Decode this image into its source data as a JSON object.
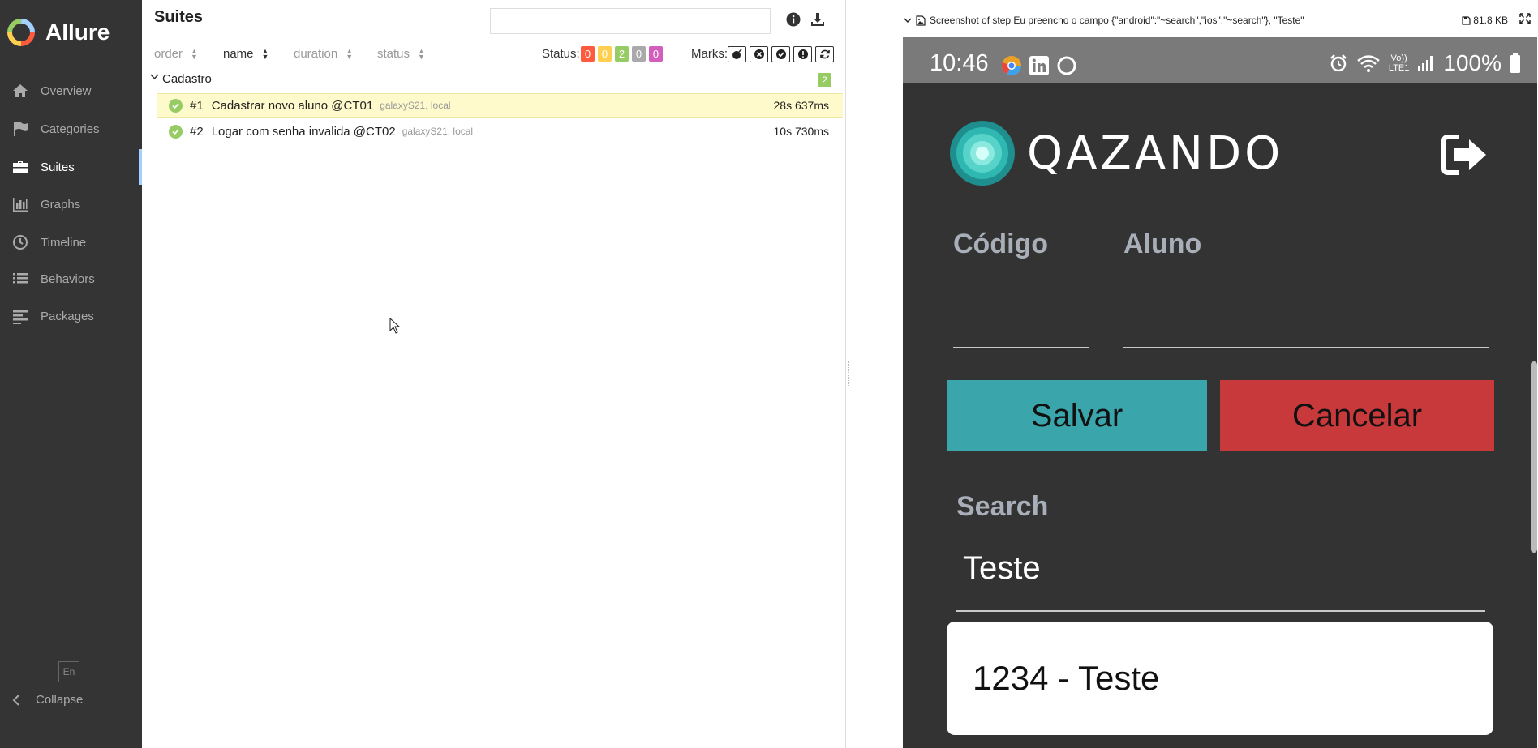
{
  "app": {
    "name": "Allure"
  },
  "sidebar": {
    "items": [
      {
        "label": "Overview"
      },
      {
        "label": "Categories"
      },
      {
        "label": "Suites"
      },
      {
        "label": "Graphs"
      },
      {
        "label": "Timeline"
      },
      {
        "label": "Behaviors"
      },
      {
        "label": "Packages"
      }
    ],
    "active": "Suites",
    "language": "En",
    "collapse_label": "Collapse"
  },
  "suites": {
    "title": "Suites",
    "search_value": "",
    "columns": [
      {
        "label": "order"
      },
      {
        "label": "name"
      },
      {
        "label": "duration"
      },
      {
        "label": "status"
      }
    ],
    "active_sort": "name",
    "status_label": "Status:",
    "status_counts": [
      {
        "value": "0",
        "color": "#fd5a3e"
      },
      {
        "value": "0",
        "color": "#ffd050"
      },
      {
        "value": "2",
        "color": "#97cc64"
      },
      {
        "value": "0",
        "color": "#aaaaaa"
      },
      {
        "value": "0",
        "color": "#d35ebe"
      }
    ],
    "marks_label": "Marks:",
    "marks": [
      "flaky-icon",
      "new-failed-icon",
      "new-passed-icon",
      "new-broken-icon",
      "retries-icon"
    ],
    "group": {
      "name": "Cadastro",
      "count": "2"
    },
    "tests": [
      {
        "num": "#1",
        "name": "Cadastrar novo aluno @CT01",
        "tags": "galaxyS21, local",
        "duration": "28s 637ms",
        "status": "passed",
        "selected": true
      },
      {
        "num": "#2",
        "name": "Logar com senha invalida @CT02",
        "tags": "galaxyS21, local",
        "duration": "10s 730ms",
        "status": "passed",
        "selected": false
      }
    ]
  },
  "attachment": {
    "title": "Screenshot of step Eu preencho o campo {\"android\":\"~search\",\"ios\":\"~search\"}, \"Teste\"",
    "size": "81.8 KB"
  },
  "phone": {
    "time": "10:46",
    "battery": "100%",
    "network": "LTE1",
    "volte": "Vo))",
    "brand": "QAZANDO",
    "label_codigo": "Código",
    "label_aluno": "Aluno",
    "btn_salvar": "Salvar",
    "btn_cancelar": "Cancelar",
    "label_search": "Search",
    "search_value": "Teste",
    "result": "1234 - Teste",
    "colors": {
      "teal": "#3aa6ab",
      "red": "#c8393b",
      "background": "#333333"
    }
  }
}
